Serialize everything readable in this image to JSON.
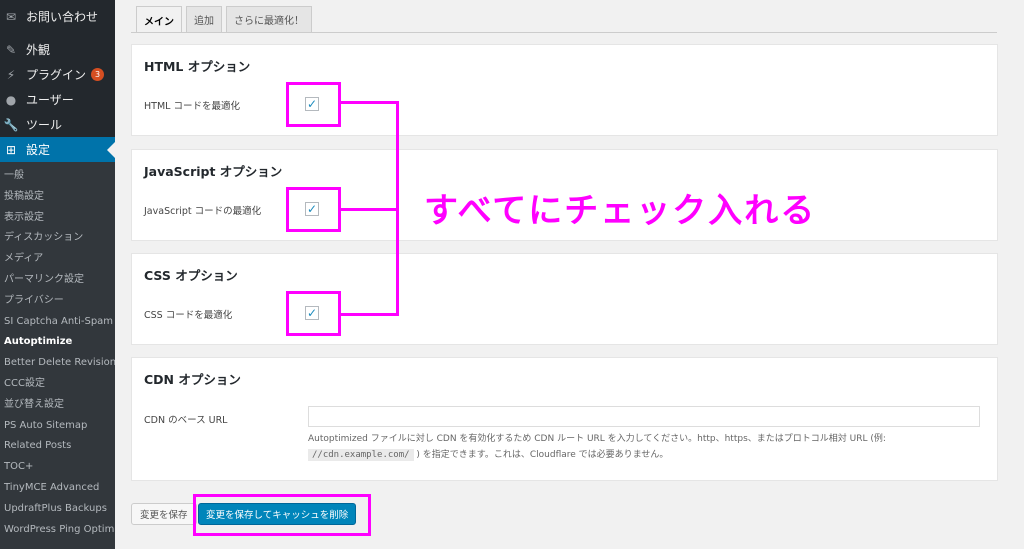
{
  "sidebar": {
    "top_items": [
      {
        "icon": "mail-icon",
        "label": "お問い合わせ"
      },
      {
        "icon": "paintbrush-icon",
        "label": "外観"
      },
      {
        "icon": "plugin-icon",
        "label": "プラグイン",
        "badge": "3"
      },
      {
        "icon": "user-icon",
        "label": "ユーザー"
      },
      {
        "icon": "wrench-icon",
        "label": "ツール"
      },
      {
        "icon": "settings-icon",
        "label": "設定",
        "active": true
      }
    ],
    "submenu": [
      "一般",
      "投稿設定",
      "表示設定",
      "ディスカッション",
      "メディア",
      "パーマリンク設定",
      "プライバシー",
      "SI Captcha Anti-Spam",
      "Autoptimize",
      "Better Delete Revision",
      "CCC設定",
      "並び替え設定",
      "PS Auto Sitemap",
      "Related Posts",
      "TOC+",
      "TinyMCE Advanced",
      "UpdraftPlus Backups",
      "WordPress Ping Optimizer"
    ],
    "current_submenu": "Autoptimize"
  },
  "tabs": [
    {
      "label": "メイン",
      "active": true
    },
    {
      "label": "追加"
    },
    {
      "label": "さらに最適化！"
    }
  ],
  "sections": {
    "html": {
      "title": "HTML オプション",
      "label": "HTML コードを最適化",
      "checked": true
    },
    "js": {
      "title": "JavaScript オプション",
      "label": "JavaScript コードの最適化",
      "checked": true
    },
    "css": {
      "title": "CSS オプション",
      "label": "CSS コードを最適化",
      "checked": true
    },
    "cdn": {
      "title": "CDN オプション",
      "label": "CDN のベース URL",
      "value": "",
      "desc_part1": "Autoptimized ファイルに対し CDN を有効化するため CDN ルート URL を入力してください。http、https、またはプロトコル相対 URL (例:",
      "desc_code": "//cdn.example.com/",
      "desc_part2": ") を指定できます。これは、Cloudflare では必要ありません。"
    }
  },
  "buttons": {
    "save": "変更を保存",
    "save_clear": "変更を保存してキャッシュを削除"
  },
  "annotation": {
    "text": "すべてにチェック入れる",
    "color": "#ff00ff"
  },
  "colors": {
    "sidebar_bg": "#23282d",
    "active_bg": "#0073aa",
    "primary_button": "#0085ba",
    "badge": "#d54e21"
  }
}
